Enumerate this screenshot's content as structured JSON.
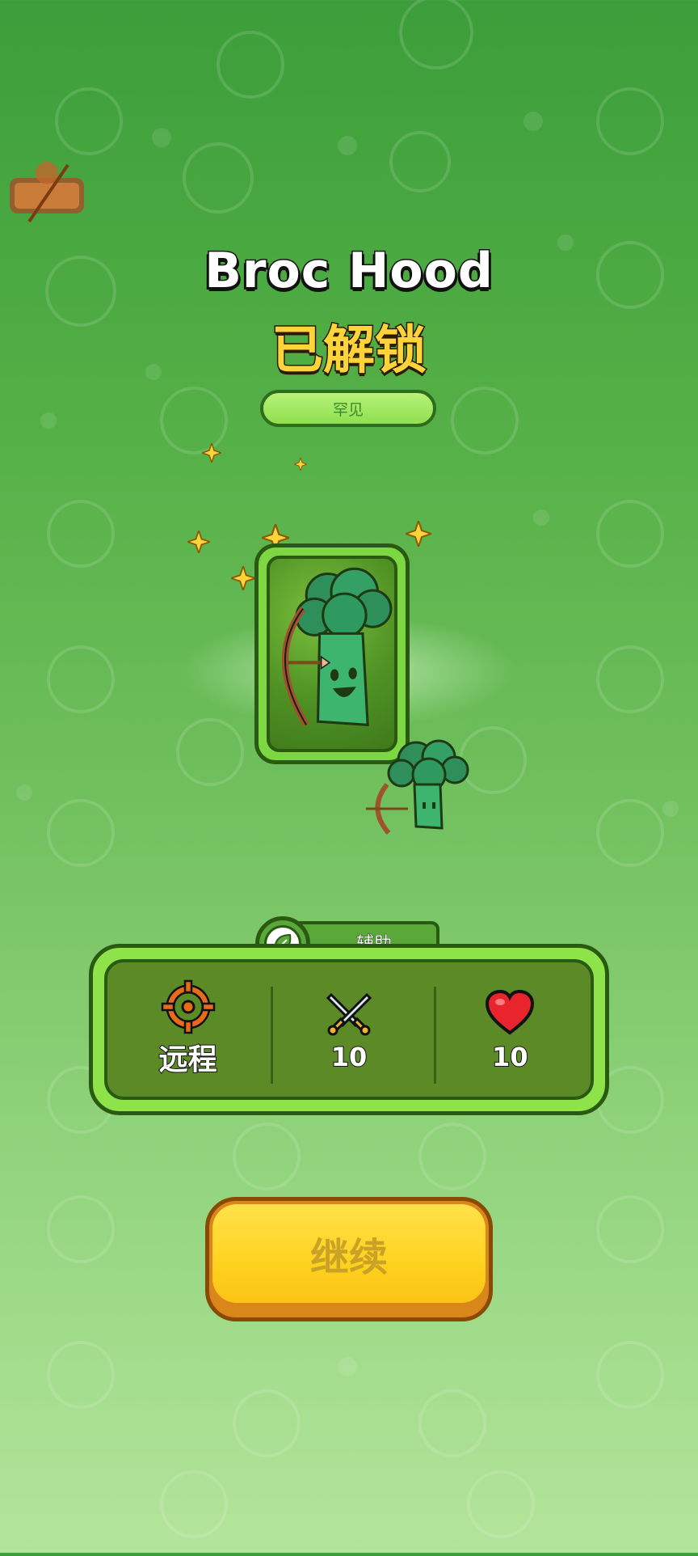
{
  "unlock": {
    "character_name": "Broc Hood",
    "status": "已解锁",
    "rarity": "罕见"
  },
  "card": {
    "character_icon": "broccoli-archer-character",
    "weapon_icon": "bow-and-arrow-icon"
  },
  "stats": {
    "role_tag": "辅助",
    "role_icon": "leaf-icon",
    "range_icon": "crosshair-icon",
    "range_label": "远程",
    "attack_icon": "crossed-swords-icon",
    "attack_value": "10",
    "health_icon": "heart-icon",
    "health_value": "10"
  },
  "actions": {
    "continue_label": "继续"
  },
  "colors": {
    "heart": "#e8242c",
    "crosshair": "#e86a1a",
    "button": "#ffd21f",
    "panel": "#5b8a26",
    "panel_border": "#8ee34a"
  }
}
